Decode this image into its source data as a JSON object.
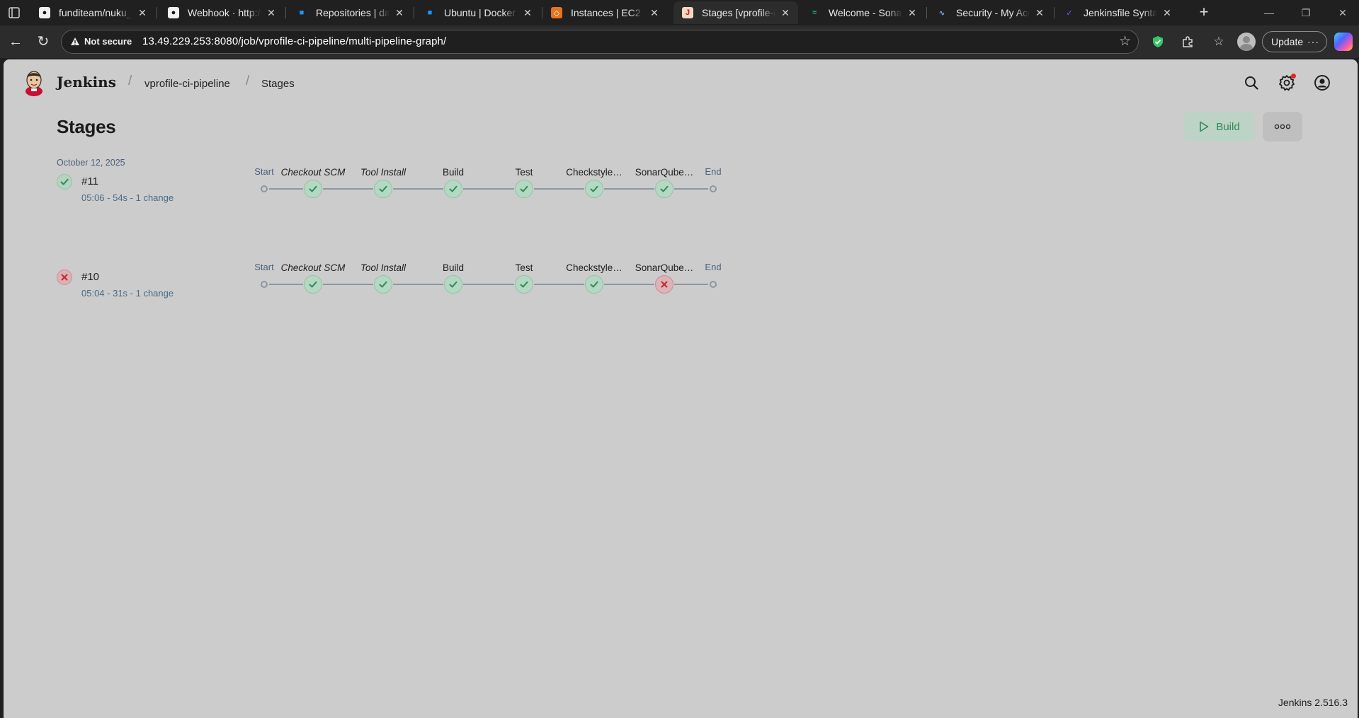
{
  "browser": {
    "tabs": [
      {
        "title": "funditeam/nuku_de",
        "icon": "github-icon"
      },
      {
        "title": "Webhook · http://1",
        "icon": "github-icon"
      },
      {
        "title": "Repositories | darkc",
        "icon": "docker-icon"
      },
      {
        "title": "Ubuntu | Docker Do",
        "icon": "docker-icon"
      },
      {
        "title": "Instances | EC2 | eu",
        "icon": "aws-icon"
      },
      {
        "title": "Stages [vprofile-ci-p",
        "icon": "jenkins-icon",
        "active": true
      },
      {
        "title": "Welcome - Sonatyp",
        "icon": "sonatype-icon"
      },
      {
        "title": "Security - My Accou",
        "icon": "sonarcloud-icon"
      },
      {
        "title": "Jenkinsfile Syntax E",
        "icon": "jenkins-docs-icon"
      }
    ],
    "not_secure_label": "Not secure",
    "url": "13.49.229.253:8080/job/vprofile-ci-pipeline/multi-pipeline-graph/",
    "update_label": "Update"
  },
  "header": {
    "brand": "Jenkins",
    "breadcrumbs": [
      "vprofile-ci-pipeline",
      "Stages"
    ]
  },
  "page": {
    "title": "Stages",
    "build_label": "Build",
    "date": "October 12, 2025",
    "footer_version": "Jenkins 2.516.3"
  },
  "stage_names": {
    "start": "Start",
    "end": "End",
    "stages": [
      {
        "name": "Checkout SCM",
        "italic": true
      },
      {
        "name": "Tool Install",
        "italic": true
      },
      {
        "name": "Build",
        "italic": false
      },
      {
        "name": "Test",
        "italic": false
      },
      {
        "name": "Checkstyle…",
        "italic": false
      },
      {
        "name": "SonarQube…",
        "italic": false
      }
    ]
  },
  "runs": [
    {
      "id": "#11",
      "meta": "05:06 - 54s - 1 change",
      "status": "success",
      "stage_status": [
        "success",
        "success",
        "success",
        "success",
        "success",
        "success"
      ]
    },
    {
      "id": "#10",
      "meta": "05:04 - 31s - 1 change",
      "status": "failed",
      "stage_status": [
        "success",
        "success",
        "success",
        "success",
        "success",
        "failed"
      ]
    }
  ],
  "colors": {
    "success": "#2e8b57",
    "failed": "#c62828",
    "page_bg": "#cccccc"
  }
}
